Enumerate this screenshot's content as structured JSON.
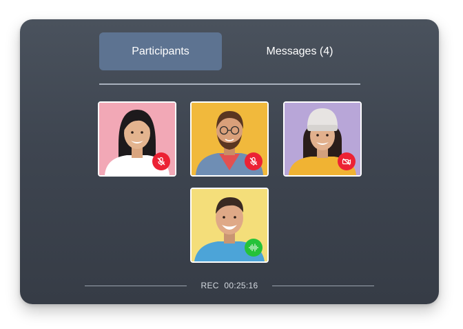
{
  "tabs": [
    {
      "label": "Participants",
      "active": true
    },
    {
      "label": "Messages (4)",
      "active": false
    }
  ],
  "participants": [
    {
      "bg": "#f2a8b6",
      "status": "muted",
      "status_icon": "mic-off-icon",
      "status_color": "#ec2234"
    },
    {
      "bg": "#f1b93c",
      "status": "muted",
      "status_icon": "mic-off-icon",
      "status_color": "#ec2234"
    },
    {
      "bg": "#b8a6d8",
      "status": "video-off",
      "status_icon": "video-off-icon",
      "status_color": "#ec2234"
    },
    {
      "bg": "#f4de7a",
      "status": "speaking",
      "status_icon": "audio-wave-icon",
      "status_color": "#25c23a"
    }
  ],
  "recording": {
    "label": "REC",
    "time": "00:25:16"
  },
  "colors": {
    "accent": "#5d7391",
    "panel": "#3e4550",
    "muted_badge": "#ec2234",
    "speaking_badge": "#25c23a"
  }
}
